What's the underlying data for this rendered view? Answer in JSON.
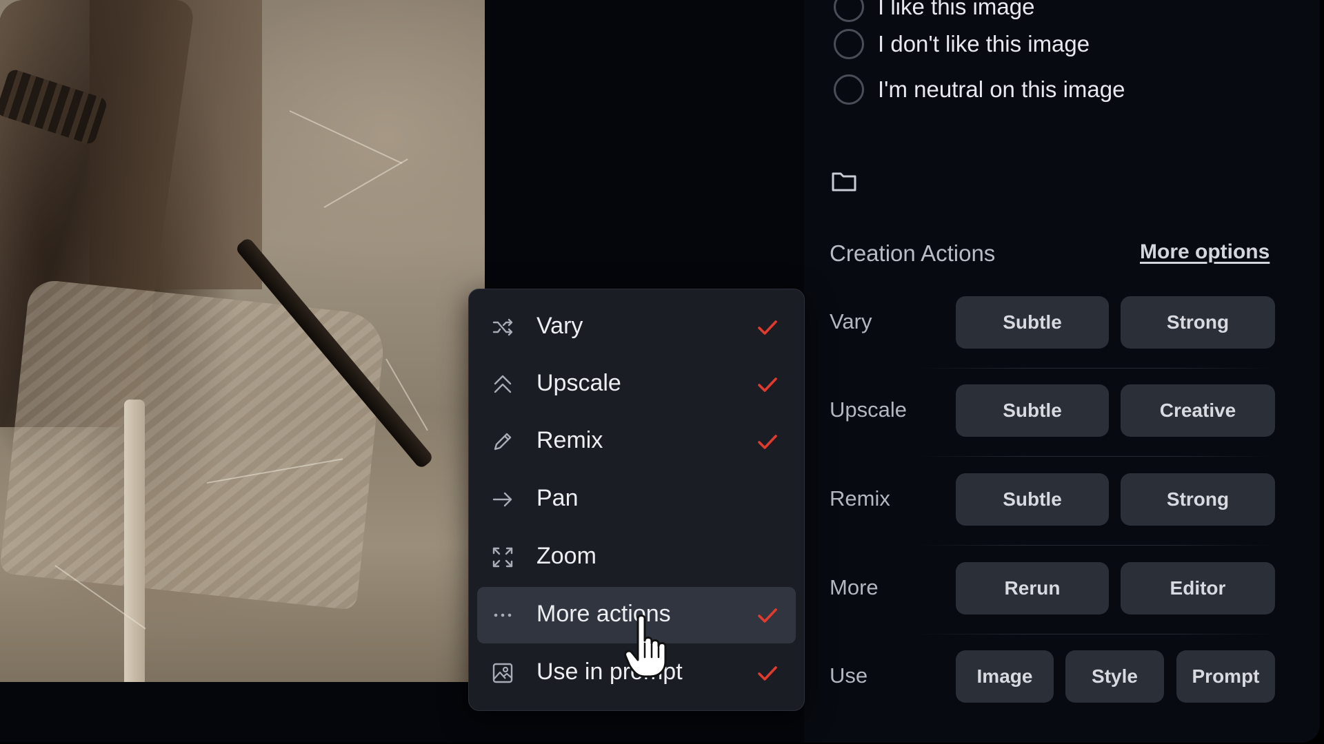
{
  "rating": {
    "options": [
      "I like this image",
      "I don't like this image",
      "I'm neutral on this image"
    ]
  },
  "creation_actions": {
    "title": "Creation Actions",
    "more_options_label": "More options",
    "rows": [
      {
        "label": "Vary",
        "buttons": [
          "Subtle",
          "Strong"
        ]
      },
      {
        "label": "Upscale",
        "buttons": [
          "Subtle",
          "Creative"
        ]
      },
      {
        "label": "Remix",
        "buttons": [
          "Subtle",
          "Strong"
        ]
      },
      {
        "label": "More",
        "buttons": [
          "Rerun",
          "Editor"
        ]
      },
      {
        "label": "Use",
        "buttons": [
          "Image",
          "Style",
          "Prompt"
        ]
      }
    ]
  },
  "menu": {
    "items": [
      {
        "label": "Vary",
        "icon": "shuffle-icon",
        "checked": true
      },
      {
        "label": "Upscale",
        "icon": "double-chevron-up-icon",
        "checked": true
      },
      {
        "label": "Remix",
        "icon": "pencil-icon",
        "checked": true
      },
      {
        "label": "Pan",
        "icon": "arrow-right-icon",
        "checked": false
      },
      {
        "label": "Zoom",
        "icon": "expand-icon",
        "checked": false
      },
      {
        "label": "More actions",
        "icon": "ellipsis-icon",
        "checked": true,
        "highlighted": true
      },
      {
        "label": "Use in prompt",
        "icon": "image-icon",
        "checked": true
      }
    ]
  },
  "colors": {
    "check": "#e23b2e",
    "button_bg": "#2b2f38",
    "menu_bg": "#1a1d24"
  }
}
